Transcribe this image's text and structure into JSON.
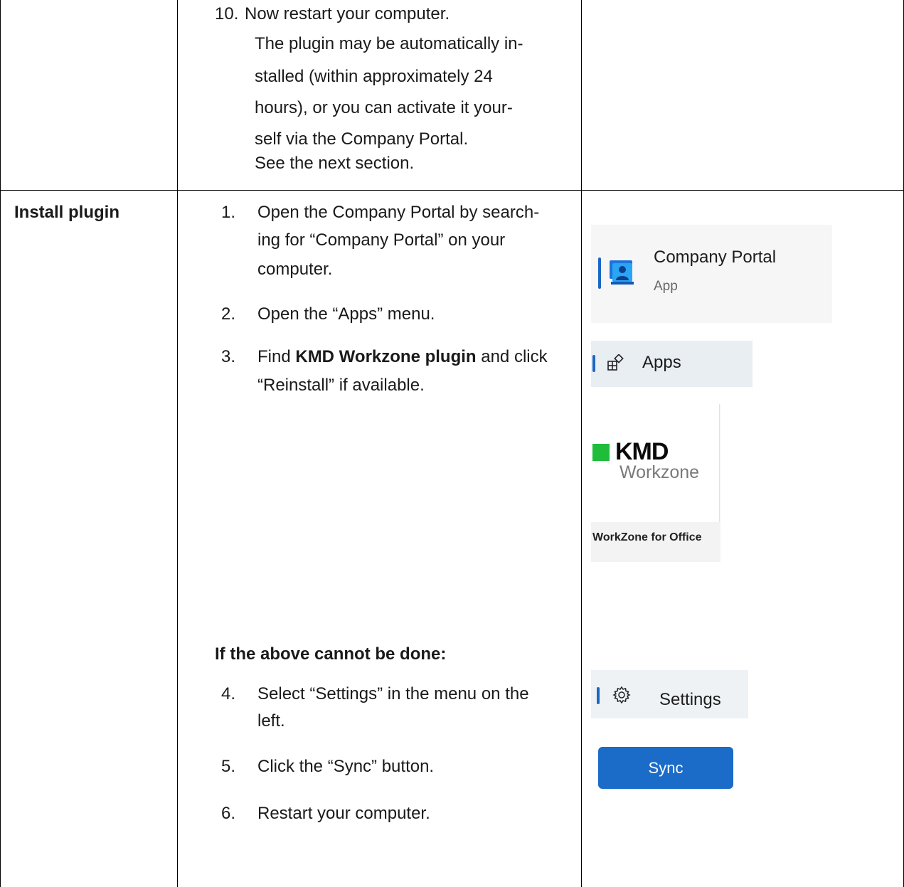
{
  "row1": {
    "step_number": "10.",
    "lines": [
      "Now restart your computer.",
      "The plugin may be automatically in-",
      "stalled (within approximately 24",
      "hours), or you can activate it your-",
      "self via the Company Portal.",
      "See the next section."
    ]
  },
  "row2": {
    "heading": "Install plugin",
    "steps": [
      {
        "number": "1.",
        "lines": [
          "Open the Company Portal by search-",
          "ing for “Company Portal” on your",
          "computer."
        ]
      },
      {
        "number": "2.",
        "lines": [
          "Open the “Apps” menu."
        ]
      },
      {
        "number": "3.",
        "bold": "KMD Workzone plugin",
        "before": "Find ",
        "after": " and click",
        "line2": "“Reinstall” if available."
      },
      {
        "number": "4.",
        "lines": [
          "Select “Settings” in the menu on the",
          "left."
        ]
      },
      {
        "number": "5.",
        "lines": [
          "Click the “Sync” button."
        ]
      },
      {
        "number": "6.",
        "lines": [
          "Restart your computer."
        ]
      }
    ],
    "subheading": "If the above cannot be done:"
  },
  "screenshots": {
    "company_portal": {
      "name": "Company Portal",
      "type": "App"
    },
    "apps_tab": {
      "label": "Apps"
    },
    "kmd_tile": {
      "brand": "KMD",
      "product": "Workzone",
      "caption": "WorkZone for Office"
    },
    "settings_tab": {
      "label": "Settings"
    },
    "sync_button": {
      "label": "Sync"
    }
  },
  "icons": {
    "company_portal": "company-portal-icon",
    "apps": "apps-icon",
    "settings": "gear-icon",
    "kmd_mark": "kmd-green-square"
  },
  "colors": {
    "accent": "#1b67c4",
    "sync_button": "#1b6bc8",
    "kmd_green": "#1fbd3a"
  }
}
